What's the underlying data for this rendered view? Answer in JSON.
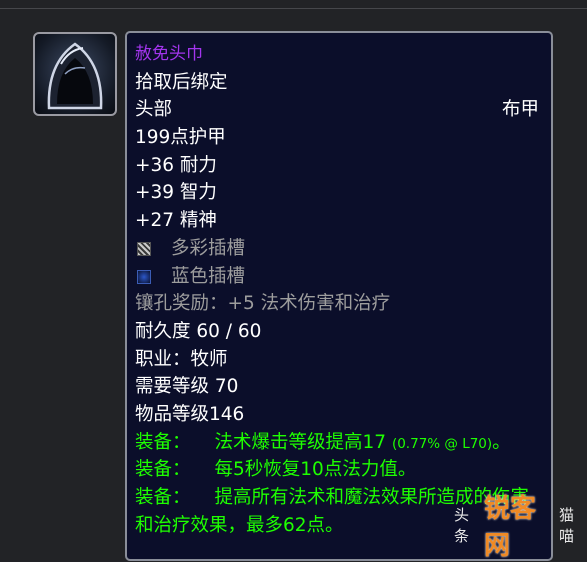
{
  "tooltip": {
    "name": "赦免头巾",
    "bind": "拾取后绑定",
    "slot": "头部",
    "armor_type": "布甲",
    "armor": "199点护甲",
    "stats": [
      "+36 耐力",
      "+39 智力",
      "+27 精神"
    ],
    "sockets": [
      {
        "label": "多彩插槽",
        "icon": "prismatic-socket-icon"
      },
      {
        "label": "蓝色插槽",
        "icon": "blue-socket-icon"
      }
    ],
    "socket_bonus": "镶孔奖励：+5 法术伤害和治疗",
    "durability": "耐久度 60 / 60",
    "class_req": "职业：牧师",
    "level_req": "需要等级 70",
    "item_level": "物品等级146",
    "equips": [
      {
        "prefix": "装备：",
        "text": "法术爆击等级提高17",
        "note": "(0.77% @ L70)",
        "suffix": "。"
      },
      {
        "prefix": "装备：",
        "text": "每5秒恢复10点法力值。"
      },
      {
        "prefix": "装备：",
        "text": "提高所有法术和魔法效果所造成的伤害和治疗效果，最多62点。"
      }
    ]
  },
  "watermark": {
    "prefix": "头条",
    "logo": "锐客网",
    "suffix": "猫喵"
  },
  "colors": {
    "epic": "#a335ee",
    "uncommon": "#1eff00",
    "background": "#0b0e2a"
  }
}
